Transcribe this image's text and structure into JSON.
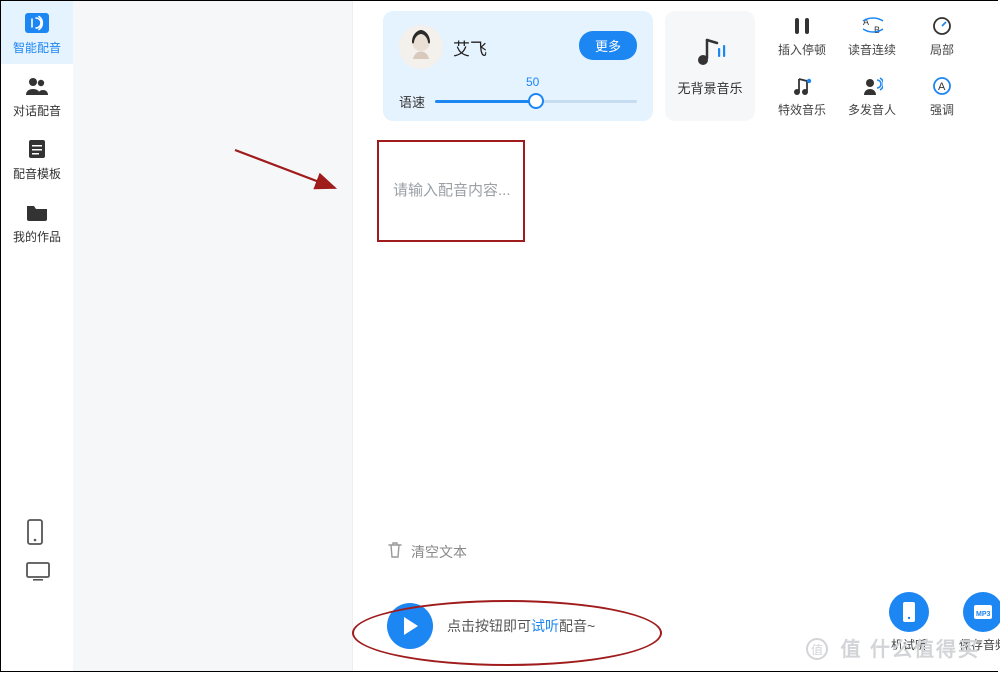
{
  "sidebar": {
    "items": [
      {
        "label": "智能配音"
      },
      {
        "label": "对话配音"
      },
      {
        "label": "配音模板"
      },
      {
        "label": "我的作品"
      }
    ]
  },
  "voice_card": {
    "name": "艾飞",
    "more": "更多",
    "speed_label": "语速",
    "speed_value": "50"
  },
  "bgm": {
    "label": "无背景音乐"
  },
  "tools": {
    "items": [
      {
        "label": "插入停顿"
      },
      {
        "label": "读音连续"
      },
      {
        "label": "局部"
      },
      {
        "label": "特效音乐"
      },
      {
        "label": "多发音人"
      },
      {
        "label": "强调"
      }
    ]
  },
  "editor": {
    "placeholder": "请输入配音内容...",
    "clear": "清空文本"
  },
  "play": {
    "hint_prefix": "点击按钮即可",
    "hint_accent": "试听",
    "hint_suffix": "配音~"
  },
  "save": {
    "phone": "机试听",
    "audio": "保存音频"
  },
  "watermark": "值    什么值得买"
}
